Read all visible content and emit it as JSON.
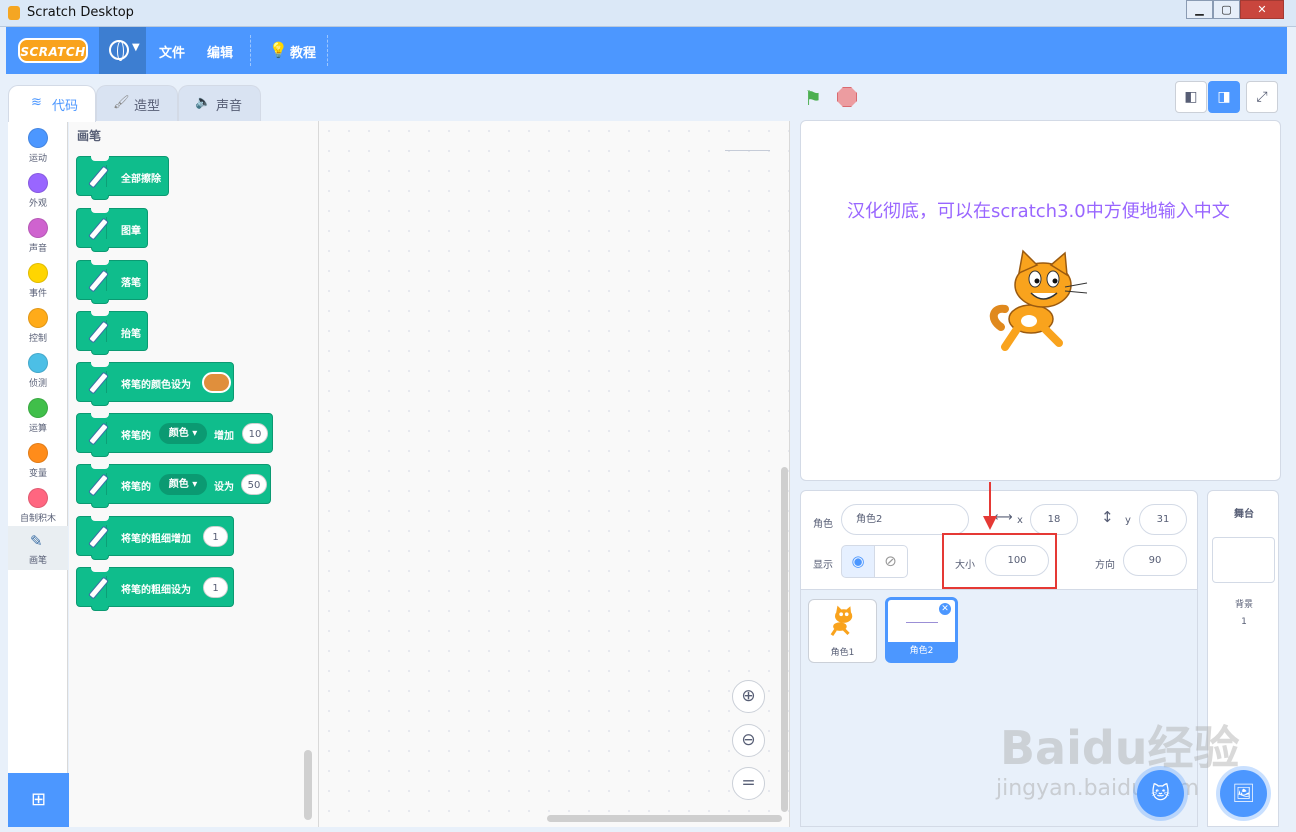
{
  "window": {
    "title": "Scratch Desktop",
    "minimize_label": "▁",
    "maximize_label": "▢",
    "close_label": "✕"
  },
  "menubar": {
    "logo_text": "SCRATCH",
    "file": "文件",
    "edit": "编辑",
    "tutorials": "教程"
  },
  "tabs": {
    "code": "代码",
    "costumes": "造型",
    "sounds": "声音"
  },
  "categories": [
    {
      "label": "运动",
      "color": "#4c97ff"
    },
    {
      "label": "外观",
      "color": "#9966ff"
    },
    {
      "label": "声音",
      "color": "#cf63cf"
    },
    {
      "label": "事件",
      "color": "#ffd500"
    },
    {
      "label": "控制",
      "color": "#ffab19"
    },
    {
      "label": "侦测",
      "color": "#4cbfe6"
    },
    {
      "label": "运算",
      "color": "#40bf4a"
    },
    {
      "label": "变量",
      "color": "#ff8c1a"
    },
    {
      "label": "自制积木",
      "color": "#ff6680"
    },
    {
      "label": "画笔",
      "color": "#0fbd8c"
    }
  ],
  "palette": {
    "title": "画笔",
    "blocks": {
      "clear": "全部擦除",
      "stamp": "图章",
      "pen_down": "落笔",
      "pen_up": "抬笔",
      "set_color_to": "将笔的颜色设为",
      "change_param_prefix": "将笔的",
      "change_param_dropdown": "颜色",
      "change_param_suffix": "增加",
      "change_param_value": "10",
      "set_param_prefix": "将笔的",
      "set_param_dropdown": "颜色",
      "set_param_suffix": "设为",
      "set_param_value": "50",
      "change_size": "将笔的粗细增加",
      "change_size_value": "1",
      "set_size": "将笔的粗细设为",
      "set_size_value": "1"
    }
  },
  "stage": {
    "text": "汉化彻底，可以在scratch3.0中方便地输入中文"
  },
  "sprite_info": {
    "sprite_label": "角色",
    "sprite_name": "角色2",
    "x_label": "x",
    "x_value": "18",
    "y_label": "y",
    "y_value": "31",
    "show_label": "显示",
    "size_label": "大小",
    "size_value": "100",
    "direction_label": "方向",
    "direction_value": "90"
  },
  "sprites": [
    {
      "name": "角色1"
    },
    {
      "name": "角色2"
    }
  ],
  "stage_panel": {
    "title": "舞台",
    "backdrops_label": "背景",
    "backdrops_count": "1"
  },
  "watermark": {
    "line1": "Baidu经验",
    "line2": "jingyan.baidu.com"
  },
  "colors": {
    "accent": "#4c97ff",
    "pen_category": "#0fbd8c",
    "stage_text": "#9966ff",
    "pen_color_swatch": "#e08f3c",
    "highlight": "#e53935"
  }
}
